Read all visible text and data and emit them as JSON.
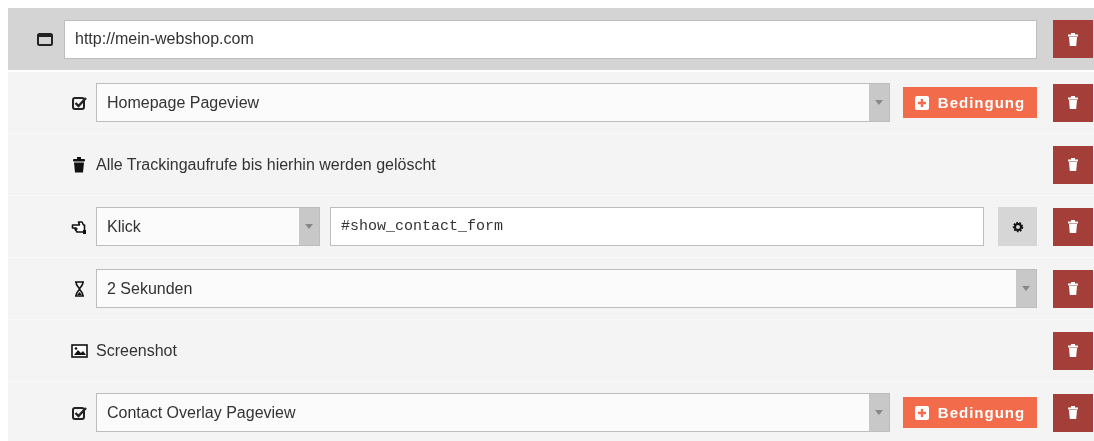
{
  "url_bar": {
    "value": "http://mein-webshop.com"
  },
  "steps": [
    {
      "kind": "pageview",
      "value": "Homepage Pageview",
      "condition_button": "Bedingung"
    },
    {
      "kind": "clear",
      "text": "Alle Trackingaufrufe bis hierhin werden gelöscht"
    },
    {
      "kind": "click",
      "value": "Klick",
      "selector": "#show_contact_form"
    },
    {
      "kind": "wait",
      "value": "2 Sekunden"
    },
    {
      "kind": "screenshot",
      "text": "Screenshot"
    },
    {
      "kind": "pageview",
      "value": "Contact Overlay Pageview",
      "condition_button": "Bedingung"
    }
  ]
}
